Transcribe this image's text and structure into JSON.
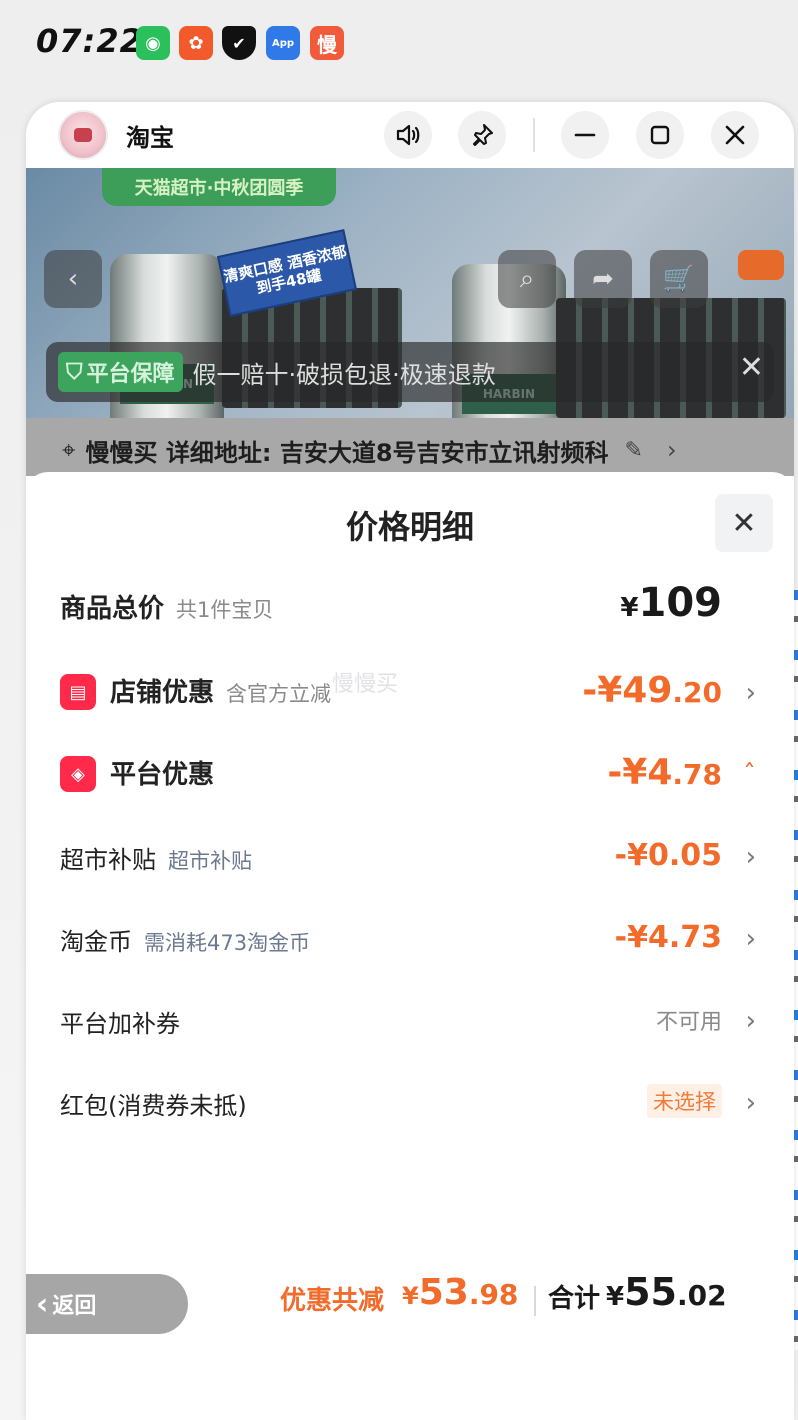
{
  "status_bar": {
    "time": "07:22",
    "icons": [
      {
        "name": "wechat-icon",
        "color": "#2cc05d",
        "glyph": "◉"
      },
      {
        "name": "kuaishou-icon",
        "color": "#f25a2c",
        "glyph": "✿"
      },
      {
        "name": "shield-icon",
        "color": "#111111",
        "glyph": "✔"
      },
      {
        "name": "appmarket-icon",
        "color": "#2f79e8",
        "glyph": "App"
      },
      {
        "name": "manmanmai-icon",
        "color": "#f15a3a",
        "glyph": "慢"
      }
    ]
  },
  "window": {
    "title": "淘宝",
    "buttons": {
      "sound": "🔊",
      "pin": "📌",
      "minimize": "—",
      "maximize": "▢",
      "close": "✕"
    }
  },
  "product_page": {
    "banner": "天猫超市·中秋团圆季",
    "promo_line1": "清爽口感 酒香浓郁",
    "promo_line2": "到手48罐",
    "can_label": "HARBIN",
    "guarantee_badge": "平台保障",
    "guarantee_text": "假一赔十·破损包退·极速退款",
    "address": "慢慢买 详细地址: 吉安大道8号吉安市立讯射频科"
  },
  "price_detail": {
    "title": "价格明细",
    "watermark": "慢慢买",
    "rows": {
      "total_goods": {
        "label": "商品总价",
        "sub": "共1件宝贝",
        "yen": "¥",
        "int": "109",
        "dec": ""
      },
      "store_discount": {
        "label": "店铺优惠",
        "sub": "含官方立减",
        "int": "-¥49",
        "dec": ".20"
      },
      "platform_discount": {
        "label": "平台优惠",
        "int": "-¥4",
        "dec": ".78"
      },
      "supermarket_subsidy": {
        "label": "超市补贴",
        "sub": "超市补贴",
        "value": "-¥0.05"
      },
      "taojinbi": {
        "label": "淘金币",
        "sub": "需消耗473淘金币",
        "value": "-¥4.73"
      },
      "platform_coupon": {
        "label": "平台加补券",
        "value": "不可用"
      },
      "red_packet": {
        "label": "红包(消费券未抵)",
        "value": "未选择"
      }
    },
    "summary": {
      "discount_label": "优惠共减",
      "discount_yen": "¥",
      "discount_int": "53",
      "discount_dec": ".98",
      "total_label": "合计",
      "total_yen": "¥",
      "total_int": "55",
      "total_dec": ".02"
    }
  },
  "back_button": {
    "label": "返回"
  },
  "colors": {
    "accent_orange": "#f26b2a",
    "icon_red": "#ff2a4a",
    "guarantee_green": "#3ca45c"
  }
}
